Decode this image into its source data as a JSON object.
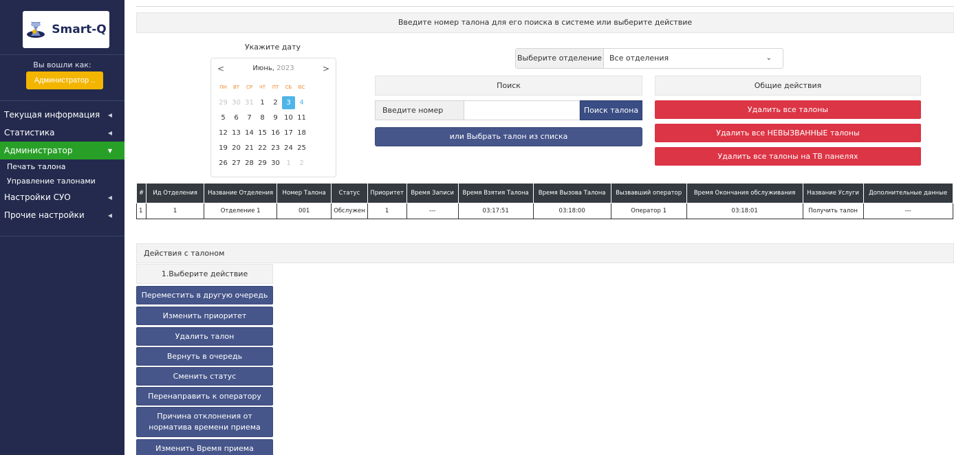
{
  "app": {
    "logo_text": "Smart-Q",
    "logged_in_label": "Вы вошли как:",
    "user_button": "Администратор .."
  },
  "sidebar": {
    "items": [
      {
        "label": "Текущая информация"
      },
      {
        "label": "Статистика"
      },
      {
        "label": "Администратор"
      },
      {
        "label": "Печать талона"
      },
      {
        "label": "Управление талонами"
      },
      {
        "label": "Настройки СУО"
      },
      {
        "label": "Прочие настройки"
      }
    ]
  },
  "banner": "Введите номер талона для его поиска в системе или выберите действие",
  "calendar": {
    "title": "Укажите дату",
    "month": "Июнь,",
    "year": "2023",
    "prev": "<",
    "next": ">",
    "dow": [
      "ПН",
      "ВТ",
      "СР",
      "ЧТ",
      "ПТ",
      "СБ",
      "ВС"
    ],
    "days": [
      "29",
      "30",
      "31",
      "1",
      "2",
      "3",
      "4",
      "5",
      "6",
      "7",
      "8",
      "9",
      "10",
      "11",
      "12",
      "13",
      "14",
      "15",
      "16",
      "17",
      "18",
      "19",
      "20",
      "21",
      "22",
      "23",
      "24",
      "25",
      "26",
      "27",
      "28",
      "29",
      "30",
      "1",
      "2"
    ],
    "selected": "3"
  },
  "department": {
    "label": "Выберите отделение",
    "value": "Все отделения"
  },
  "search": {
    "header": "Поиск",
    "prefix": "Введите номер талона",
    "input_value": "",
    "button": "Поиск талона",
    "pick_button": "или Выбрать талон из списка"
  },
  "general": {
    "header": "Общие действия",
    "delete_all": "Удалить все талоны",
    "delete_uncalled": "Удалить все НЕВЫЗВАННЫЕ талоны",
    "delete_tv": "Удалить все талоны на ТВ панелях"
  },
  "table": {
    "headers": [
      "#",
      "Ид Отделения",
      "Название Отделения",
      "Номер Талона",
      "Статус",
      "Приоритет",
      "Время Записи",
      "Время Взятия Талона",
      "Время Вызова Талона",
      "Вызвавший оператор",
      "Время Окончания обслуживания",
      "Название Услуги",
      "Дополнительные данные"
    ],
    "rows": [
      [
        "1",
        "1",
        "Отделение 1",
        "001",
        "Обслужен",
        "1",
        "---",
        "03:17:51",
        "03:18:00",
        "Оператор 1",
        "03:18:01",
        "Получить талон",
        "---"
      ]
    ]
  },
  "actions": {
    "header": "Действия с талоном",
    "title": "1.Выберите действие",
    "buttons": [
      "Переместить в другую очередь",
      "Изменить приоритет",
      "Удалить талон",
      "Вернуть в очередь",
      "Сменить статус",
      "Перенаправить к оператору",
      "Причина отклонения от норматива времени приема",
      "Изменить Время приема"
    ]
  },
  "colors": {
    "sidebar_bg": "#232a4d",
    "active_nav": "#28a028",
    "user_button": "#f3b500",
    "danger": "#dc3545",
    "primary": "#46558a",
    "calendar_selected": "#4fb5e8"
  }
}
